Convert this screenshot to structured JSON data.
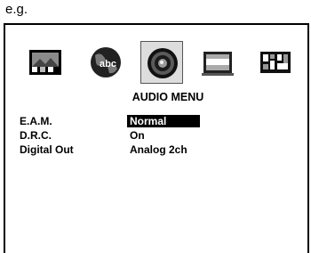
{
  "caption": "e.g.",
  "menu": {
    "title": "AUDIO MENU",
    "icons": [
      {
        "name": "picture-icon",
        "selected": false
      },
      {
        "name": "language-globe-icon",
        "selected": false
      },
      {
        "name": "speaker-audio-icon",
        "selected": true
      },
      {
        "name": "screen-display-icon",
        "selected": false
      },
      {
        "name": "parental-control-icon",
        "selected": false
      }
    ],
    "rows": [
      {
        "label": "E.A.M.",
        "value": "Normal",
        "highlighted": true
      },
      {
        "label": "D.R.C.",
        "value": "On",
        "highlighted": false
      },
      {
        "label": "Digital Out",
        "value": "Analog 2ch",
        "highlighted": false
      }
    ]
  }
}
